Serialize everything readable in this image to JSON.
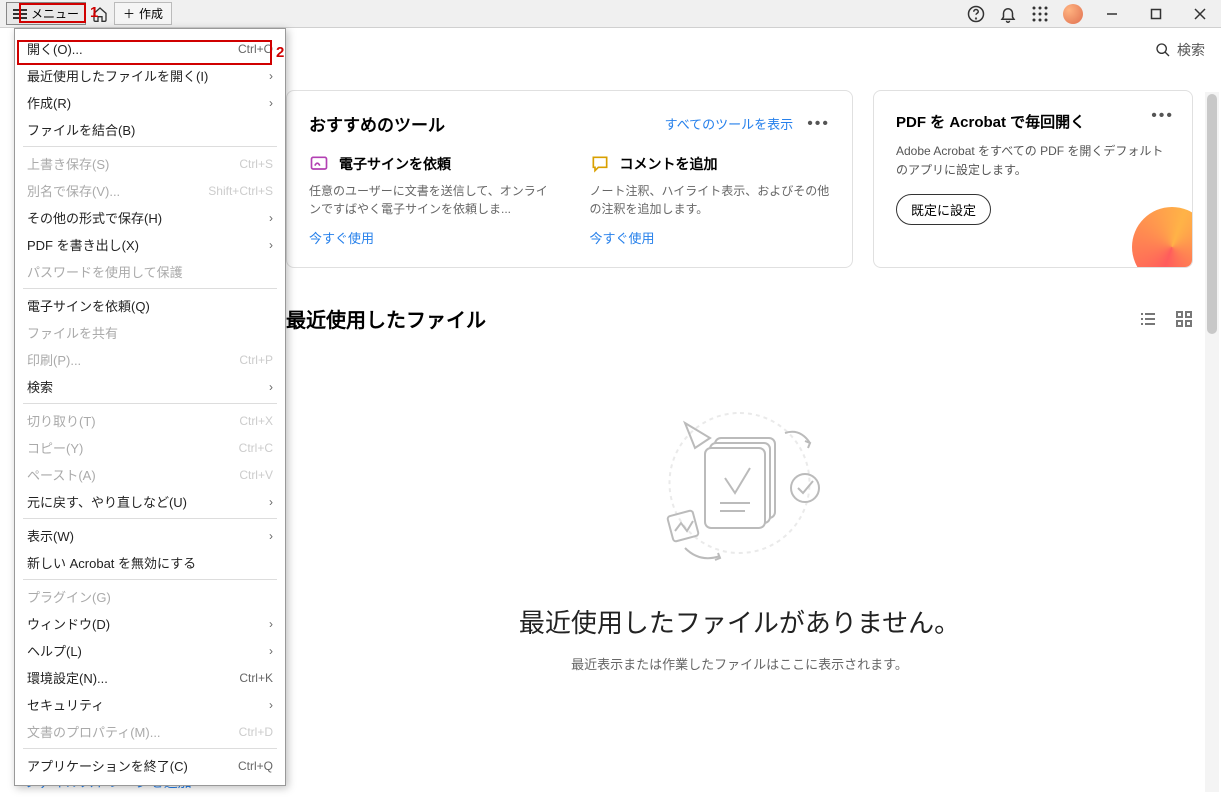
{
  "topbar": {
    "menu_label": "メニュー",
    "create_label": "作成"
  },
  "annotations": {
    "one": "1",
    "two": "2"
  },
  "search_label": "検索",
  "menu": {
    "open": {
      "label": "開く(O)...",
      "shortcut": "Ctrl+O"
    },
    "recent": {
      "label": "最近使用したファイルを開く(I)"
    },
    "create": {
      "label": "作成(R)"
    },
    "combine": {
      "label": "ファイルを結合(B)"
    },
    "save": {
      "label": "上書き保存(S)",
      "shortcut": "Ctrl+S"
    },
    "saveas": {
      "label": "別名で保存(V)...",
      "shortcut": "Shift+Ctrl+S"
    },
    "saveother": {
      "label": "その他の形式で保存(H)"
    },
    "exportpdf": {
      "label": "PDF を書き出し(X)"
    },
    "password": {
      "label": "パスワードを使用して保護"
    },
    "esign": {
      "label": "電子サインを依頼(Q)"
    },
    "share": {
      "label": "ファイルを共有"
    },
    "print": {
      "label": "印刷(P)...",
      "shortcut": "Ctrl+P"
    },
    "search": {
      "label": "検索"
    },
    "cut": {
      "label": "切り取り(T)",
      "shortcut": "Ctrl+X"
    },
    "copy": {
      "label": "コピー(Y)",
      "shortcut": "Ctrl+C"
    },
    "paste": {
      "label": "ペースト(A)",
      "shortcut": "Ctrl+V"
    },
    "undo": {
      "label": "元に戻す、やり直しなど(U)"
    },
    "view": {
      "label": "表示(W)"
    },
    "disable": {
      "label": "新しい Acrobat を無効にする"
    },
    "plugin": {
      "label": "プラグイン(G)"
    },
    "window": {
      "label": "ウィンドウ(D)"
    },
    "help": {
      "label": "ヘルプ(L)"
    },
    "prefs": {
      "label": "環境設定(N)...",
      "shortcut": "Ctrl+K"
    },
    "security": {
      "label": "セキュリティ"
    },
    "docprops": {
      "label": "文書のプロパティ(M)...",
      "shortcut": "Ctrl+D"
    },
    "quit": {
      "label": "アプリケーションを終了(C)",
      "shortcut": "Ctrl+Q"
    }
  },
  "tools": {
    "title": "おすすめのツール",
    "all": "すべてのツールを表示",
    "esign": {
      "name": "電子サインを依頼",
      "desc": "任意のユーザーに文書を送信して、オンラインですばやく電子サインを依頼しま...",
      "use": "今すぐ使用"
    },
    "comment": {
      "name": "コメントを追加",
      "desc": "ノート注釈、ハイライト表示、およびその他の注釈を追加します。",
      "use": "今すぐ使用"
    }
  },
  "promo": {
    "title": "PDF を Acrobat で毎回開く",
    "desc": "Adobe Acrobat をすべての PDF を開くデフォルトのアプリに設定します。",
    "button": "既定に設定"
  },
  "recent": {
    "title": "最近使用したファイル",
    "empty_title": "最近使用したファイルがありません。",
    "empty_sub": "最近表示または作業したファイルはここに表示されます。"
  },
  "storage_link": "ファイルストレージを追加",
  "more": "•••"
}
